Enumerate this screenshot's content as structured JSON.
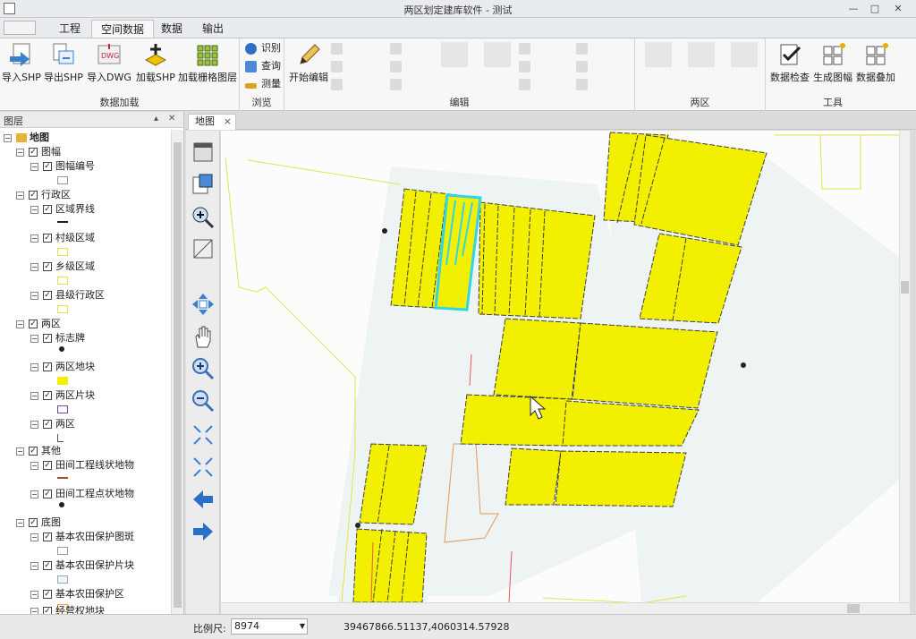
{
  "window": {
    "title": "两区划定建库软件 - 测试"
  },
  "tabs": [
    "工程",
    "空间数据",
    "数据",
    "输出"
  ],
  "ribbon": {
    "load": {
      "label": "数据加载",
      "buttons": [
        "导入SHP",
        "导出SHP",
        "导入DWG",
        "加载SHP",
        "加载栅格图层"
      ]
    },
    "browse": {
      "label": "浏览",
      "buttons": [
        "识别",
        "查询",
        "测量"
      ]
    },
    "edit": {
      "label": "编辑",
      "start": "开始编辑"
    },
    "twozone": {
      "label": "两区"
    },
    "tools": {
      "label": "工具",
      "buttons": [
        "数据检查",
        "生成图幅",
        "数据叠加"
      ]
    }
  },
  "layers": {
    "title": "图层",
    "root": "地图",
    "groups": [
      {
        "name": "图幅",
        "items": [
          "图幅编号"
        ]
      },
      {
        "name": "行政区",
        "items": [
          "区域界线",
          "村级区域",
          "乡级区域",
          "县级行政区"
        ]
      },
      {
        "name": "两区",
        "items": [
          "标志牌",
          "两区地块",
          "两区片块",
          "两区"
        ]
      },
      {
        "name": "其他",
        "items": [
          "田间工程线状地物",
          "田间工程点状地物"
        ]
      },
      {
        "name": "底图",
        "items": [
          "基本农田保护图斑",
          "基本农田保护片块",
          "基本农田保护区",
          "经营权地块"
        ]
      }
    ]
  },
  "doc_tab": "地图",
  "status": {
    "scale_label": "比例尺:",
    "scale_value": "8974",
    "coordinates": "39467866.51137,4060314.57928"
  },
  "colors": {
    "parcel_fill": "#f2f000",
    "selected_outline": "#30d6e6",
    "boundary": "#e6e24a",
    "ribbon_bg": "#f7f7f7"
  }
}
